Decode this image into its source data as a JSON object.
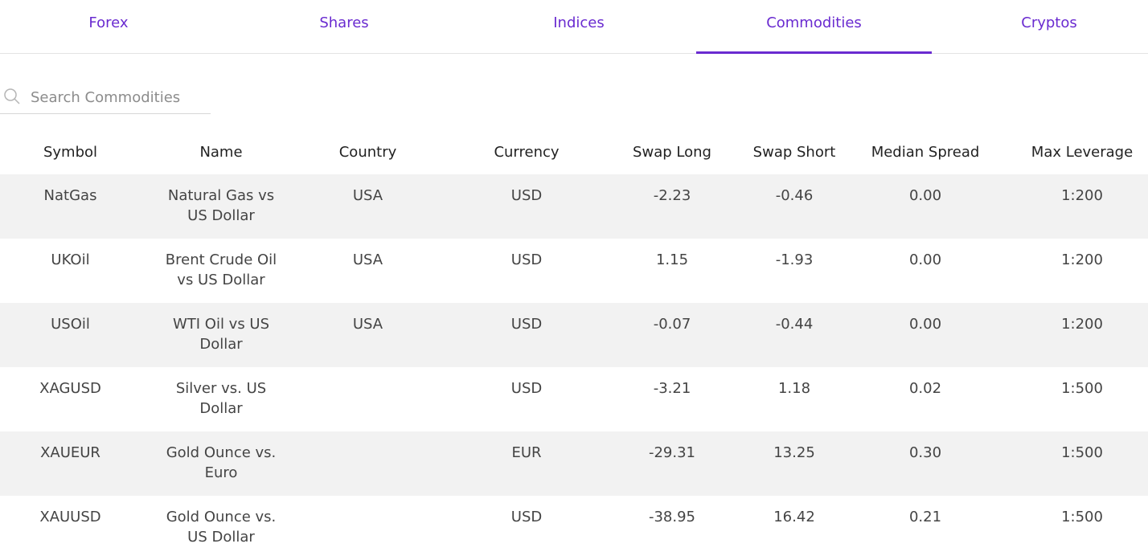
{
  "tabs": [
    {
      "label": "Forex"
    },
    {
      "label": "Shares"
    },
    {
      "label": "Indices"
    },
    {
      "label": "Commodities"
    },
    {
      "label": "Cryptos"
    }
  ],
  "active_tab": "Commodities",
  "search": {
    "placeholder": "Search Commodities",
    "value": ""
  },
  "table": {
    "headers": [
      "Symbol",
      "Name",
      "Country",
      "Currency",
      "Swap Long",
      "Swap Short",
      "Median Spread",
      "Max Leverage"
    ],
    "rows": [
      [
        "NatGas",
        "Natural Gas vs US Dollar",
        "USA",
        "USD",
        "-2.23",
        "-0.46",
        "0.00",
        "1:200"
      ],
      [
        "UKOil",
        "Brent Crude Oil vs US Dollar",
        "USA",
        "USD",
        "1.15",
        "-1.93",
        "0.00",
        "1:200"
      ],
      [
        "USOil",
        "WTI Oil vs US Dollar",
        "USA",
        "USD",
        "-0.07",
        "-0.44",
        "0.00",
        "1:200"
      ],
      [
        "XAGUSD",
        "Silver vs. US Dollar",
        "",
        "USD",
        "-3.21",
        "1.18",
        "0.02",
        "1:500"
      ],
      [
        "XAUEUR",
        "Gold Ounce vs. Euro",
        "",
        "EUR",
        "-29.31",
        "13.25",
        "0.30",
        "1:500"
      ],
      [
        "XAUUSD",
        "Gold Ounce vs. US Dollar",
        "",
        "USD",
        "-38.95",
        "16.42",
        "0.21",
        "1:500"
      ]
    ]
  },
  "colors": {
    "accent": "#6a2bd0",
    "row_alt": "#f2f2f2"
  },
  "icons": {
    "search": "search-icon"
  }
}
